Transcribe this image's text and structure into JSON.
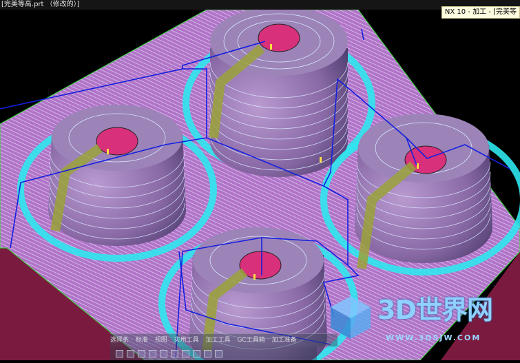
{
  "window": {
    "title": "[完美等高.prt （修改的）]",
    "app_title": "NX 10 - 加工 - [完美等"
  },
  "toolbar": {
    "items": [
      "选择条",
      "标准",
      "视图",
      "实用工具",
      "加工工具",
      "GC工具箱",
      "加工准备"
    ]
  },
  "watermark": {
    "title": "3D世界网",
    "url": "WWW.3DSJW.COM"
  },
  "colors": {
    "background": "#000000",
    "stock_top": "#b274c8",
    "stock_side": "#7a1a3e",
    "boss_body": "#8e6ca6",
    "boss_top": "#d8307a",
    "toolpath_lines": "#d8e6ff",
    "cyan_contour": "#2fe7ee",
    "non_cut_moves": "#1420e0",
    "ramp_path": "#9aa23a",
    "step_marker": "#ffe040"
  }
}
